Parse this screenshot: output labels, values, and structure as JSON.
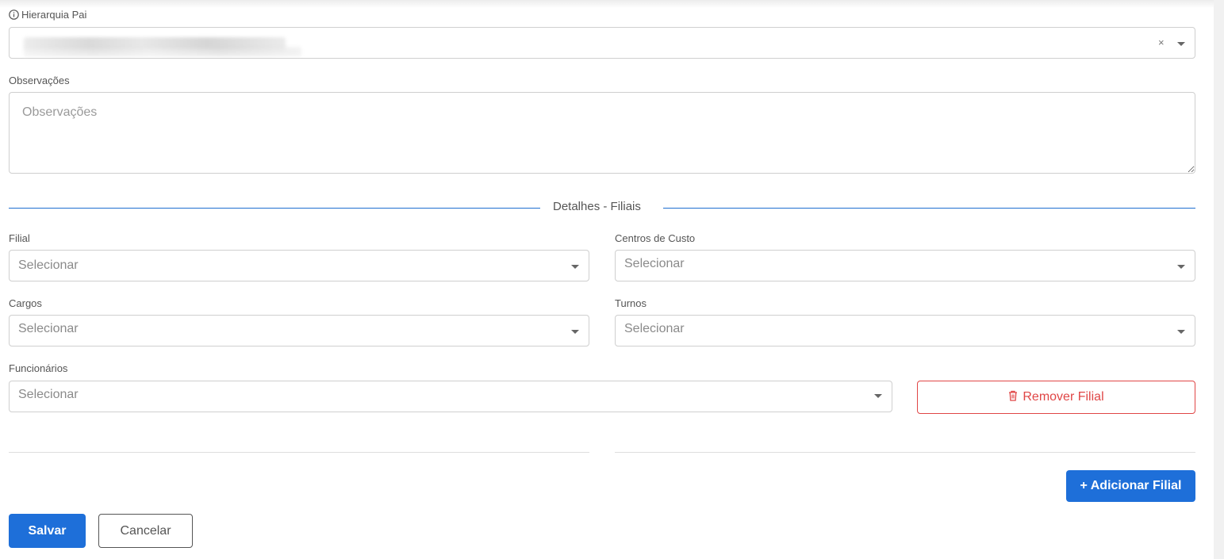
{
  "form": {
    "hierarquia_pai": {
      "label": "Hierarquia Pai"
    },
    "observacoes": {
      "label": "Observações",
      "placeholder": "Observações"
    },
    "section_title": "Detalhes - Filiais",
    "filial": {
      "label": "Filial",
      "placeholder": "Selecionar"
    },
    "centros_custo": {
      "label": "Centros de Custo",
      "placeholder": "Selecionar"
    },
    "cargos": {
      "label": "Cargos",
      "placeholder": "Selecionar"
    },
    "turnos": {
      "label": "Turnos",
      "placeholder": "Selecionar"
    },
    "funcionarios": {
      "label": "Funcionários",
      "placeholder": "Selecionar"
    },
    "remove_button": "Remover Filial",
    "add_button": "+ Adicionar Filial",
    "save_button": "Salvar",
    "cancel_button": "Cancelar"
  },
  "colors": {
    "primary": "#1e6fd9",
    "danger": "#e04646",
    "divider": "#1f6fd1"
  },
  "icons": {
    "info": "info-icon",
    "clear": "clear-icon",
    "dropdown": "chevron-down-icon",
    "trash": "trash-icon"
  }
}
